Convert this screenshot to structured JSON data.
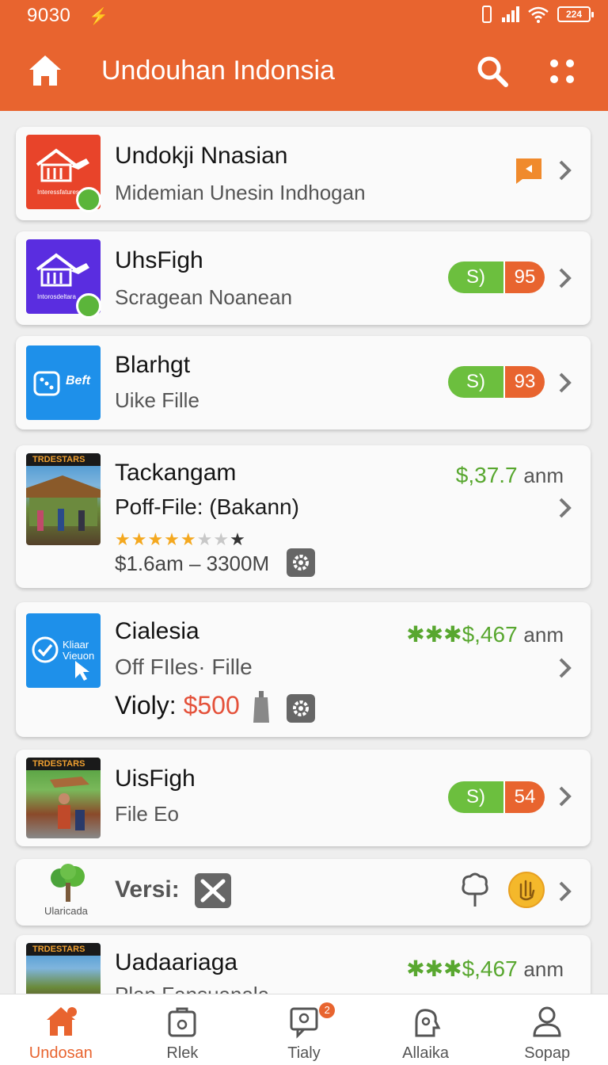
{
  "status_bar": {
    "time": "9030",
    "bolt": "⚡",
    "battery": "224"
  },
  "app_bar": {
    "title": "Undouhan Indonsia"
  },
  "items": [
    {
      "title": "Undokji Nnasian",
      "subtitle": "Midemian Unesin Indhogan",
      "thumb_text": "Interessfatures"
    },
    {
      "title": "UhsFigh",
      "subtitle": "Scragean Noanean",
      "thumb_text": "Intorosdeltara",
      "pill_left": "S)",
      "pill_right": "95"
    },
    {
      "title": "Blarhgt",
      "subtitle": "Uike Fille",
      "thumb_text": "Beft",
      "pill_left": "S)",
      "pill_right": "93"
    },
    {
      "title": "Tackangam",
      "subtitle": "Poff-File: (Bakann)",
      "thumb_text": "TRDESTARS",
      "price": "$,37.7",
      "price_unit": "anm",
      "stars_gold": "★★★★★",
      "stars_grey": "★★",
      "stars_dark": "★",
      "range": "$1.6am – 3300M"
    },
    {
      "title": "Cialesia",
      "subtitle": "Off FIles· Fille",
      "thumb_text_1": "Kliaar",
      "thumb_text_2": "Vieuon",
      "price": "✱✱✱$,467",
      "price_unit": "anm",
      "violy_label": "Violy:",
      "violy_value": "$500"
    },
    {
      "title": "UisFigh",
      "subtitle": "File Eo",
      "thumb_text": "TRDESTARS",
      "pill_left": "S)",
      "pill_right": "54"
    },
    {
      "title": "Versi:",
      "thumb_text": "Ularicada"
    },
    {
      "title": "Uadaariaga",
      "subtitle": "Plan Fansuanala",
      "thumb_text": "TRDESTARS",
      "price": "✱✱✱$,467",
      "price_unit": "anm"
    }
  ],
  "bottom_nav": [
    {
      "label": "Undosan",
      "icon": "home-icon",
      "active": true
    },
    {
      "label": "Rlek",
      "icon": "bag-icon"
    },
    {
      "label": "Tialy",
      "icon": "chat-icon",
      "badge": "2"
    },
    {
      "label": "Allaika",
      "icon": "puzzle-icon"
    },
    {
      "label": "Sopap",
      "icon": "profile-icon"
    }
  ],
  "colors": {
    "brand": "#e8642f",
    "green": "#6cbf3e",
    "price_red": "#e4513a",
    "yellow": "#f4b82b"
  }
}
